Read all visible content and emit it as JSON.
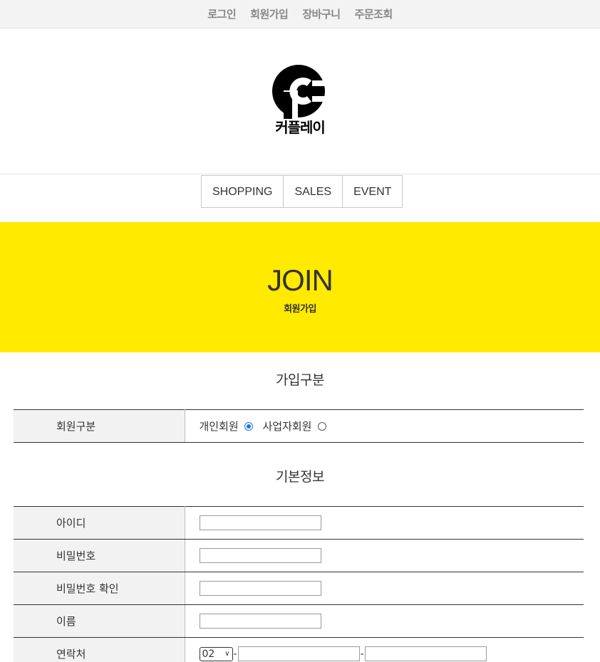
{
  "topbar": {
    "links": [
      "로그인",
      "회원가입",
      "장바구니",
      "주문조회"
    ]
  },
  "logo": {
    "text": "커플레이",
    "icon": "logo-p-icon"
  },
  "mainnav": {
    "items": [
      "SHOPPING",
      "SALES",
      "EVENT"
    ]
  },
  "hero": {
    "title": "JOIN",
    "subtitle": "회원가입",
    "background": "#ffea00"
  },
  "join_type": {
    "section_title": "가입구분",
    "label": "회원구분",
    "options": [
      {
        "label": "개인회원",
        "selected": true
      },
      {
        "label": "사업자회원",
        "selected": false
      }
    ]
  },
  "basic_info": {
    "section_title": "기본정보",
    "fields": [
      {
        "label": "아이디",
        "value": ""
      },
      {
        "label": "비밀번호",
        "value": ""
      },
      {
        "label": "비밀번호 확인",
        "value": ""
      },
      {
        "label": "이름",
        "value": ""
      }
    ],
    "phone": {
      "label": "연락처",
      "area_code": "02",
      "separator": "-",
      "middle": "",
      "last": ""
    }
  },
  "colors": {
    "accent_yellow": "#ffea00",
    "radio_selected": "#1a73e8"
  }
}
